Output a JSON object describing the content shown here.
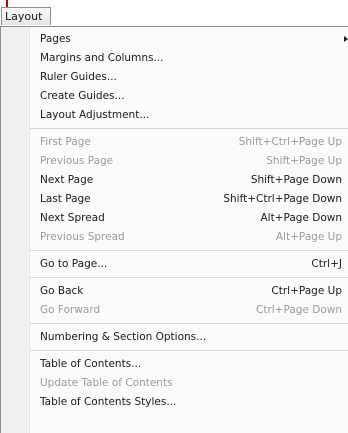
{
  "menubar": {
    "active_menu": "Layout"
  },
  "menu": {
    "groups": [
      [
        {
          "label": "Pages",
          "shortcut": "",
          "disabled": false,
          "submenu": true
        },
        {
          "label": "Margins and Columns...",
          "shortcut": "",
          "disabled": false,
          "submenu": false
        },
        {
          "label": "Ruler Guides...",
          "shortcut": "",
          "disabled": false,
          "submenu": false
        },
        {
          "label": "Create Guides...",
          "shortcut": "",
          "disabled": false,
          "submenu": false
        },
        {
          "label": "Layout Adjustment...",
          "shortcut": "",
          "disabled": false,
          "submenu": false
        }
      ],
      [
        {
          "label": "First Page",
          "shortcut": "Shift+Ctrl+Page Up",
          "disabled": true,
          "submenu": false
        },
        {
          "label": "Previous Page",
          "shortcut": "Shift+Page Up",
          "disabled": true,
          "submenu": false
        },
        {
          "label": "Next Page",
          "shortcut": "Shift+Page Down",
          "disabled": false,
          "submenu": false
        },
        {
          "label": "Last Page",
          "shortcut": "Shift+Ctrl+Page Down",
          "disabled": false,
          "submenu": false
        },
        {
          "label": "Next Spread",
          "shortcut": "Alt+Page Down",
          "disabled": false,
          "submenu": false
        },
        {
          "label": "Previous Spread",
          "shortcut": "Alt+Page Up",
          "disabled": true,
          "submenu": false
        }
      ],
      [
        {
          "label": "Go to Page...",
          "shortcut": "Ctrl+J",
          "disabled": false,
          "submenu": false
        }
      ],
      [
        {
          "label": "Go Back",
          "shortcut": "Ctrl+Page Up",
          "disabled": false,
          "submenu": false
        },
        {
          "label": "Go Forward",
          "shortcut": "Ctrl+Page Down",
          "disabled": true,
          "submenu": false
        }
      ],
      [
        {
          "label": "Numbering & Section Options...",
          "shortcut": "",
          "disabled": false,
          "submenu": false
        }
      ],
      [
        {
          "label": "Table of Contents...",
          "shortcut": "",
          "disabled": false,
          "submenu": false
        },
        {
          "label": "Update Table of Contents",
          "shortcut": "",
          "disabled": true,
          "submenu": false
        },
        {
          "label": "Table of Contents Styles...",
          "shortcut": "",
          "disabled": false,
          "submenu": false
        }
      ]
    ]
  },
  "colors": {
    "text": "#1a1a1a",
    "disabled_text": "#9b9b9b",
    "marker": "#c00000"
  }
}
